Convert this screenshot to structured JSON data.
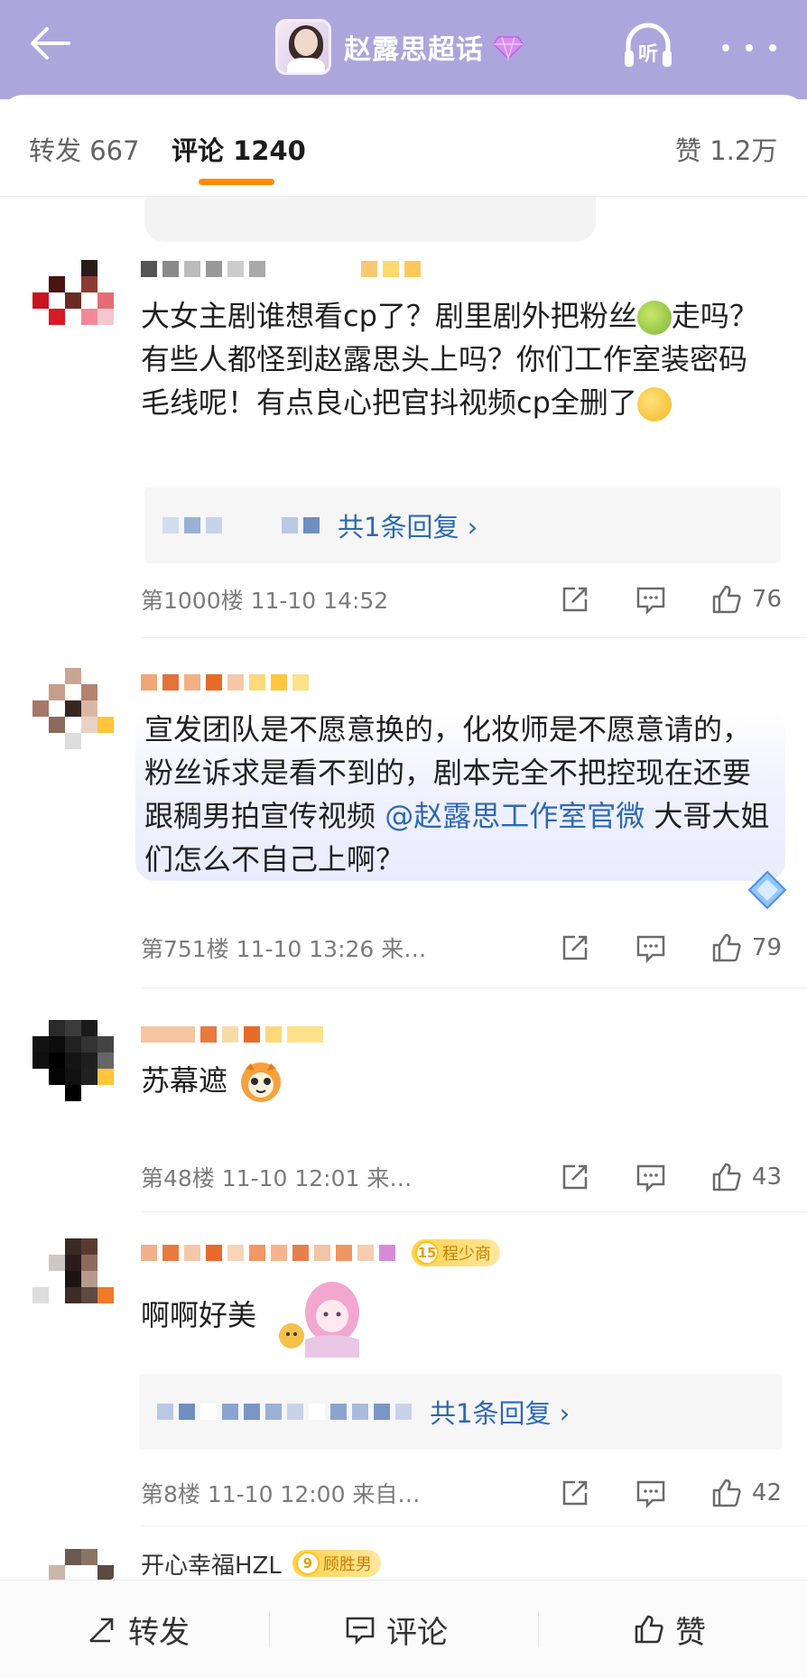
{
  "header": {
    "title": "赵露思超话",
    "listen_label": "听",
    "colors": {
      "bar": "#ada6dc",
      "accent": "#ff8a00",
      "link": "#2c69b3"
    }
  },
  "tabs": {
    "repost": "转发 667",
    "comments": "评论 1240",
    "likes": "赞 1.2万"
  },
  "comments": [
    {
      "text": "大女主剧谁想看cp了？剧里剧外把粉丝🤢走吗？有些人都怪到赵露思头上吗？你们工作室装密码毛线呢！有点良心把官抖视频cp全删了😓",
      "text_parts": [
        "大女主剧谁想看cp了？剧里剧外把粉丝",
        "走吗？有些人都怪到赵露思头上吗？你们工作室装密码毛线呢！有点良心把官抖视频cp全删了"
      ],
      "reply": "共1条回复 ›",
      "meta": "第1000楼  11-10 14:52",
      "likes": "76"
    },
    {
      "text_parts": [
        "宣发团队是不愿意换的，化妆师是不愿意请的，粉丝诉求是看不到的，剧本完全不把控现在还要跟稠男拍宣传视频 ",
        "@赵露思工作室官微",
        " 大哥大姐们怎么不自己上啊？"
      ],
      "meta": "第751楼  11-10 13:26  来…",
      "likes": "79"
    },
    {
      "text": "苏幕遮",
      "meta": "第48楼  11-10 12:01  来…",
      "likes": "43"
    },
    {
      "text": "啊啊好美",
      "badge_level": "15",
      "badge_text": "程少商",
      "reply": "共1条回复 ›",
      "meta": "第8楼  11-10 12:00  来自…",
      "likes": "42"
    },
    {
      "username": "开心幸福HZL",
      "badge_level": "9",
      "badge_text": "顾胜男"
    }
  ],
  "bottom_bar": {
    "repost": "转发",
    "comment": "评论",
    "like": "赞"
  }
}
